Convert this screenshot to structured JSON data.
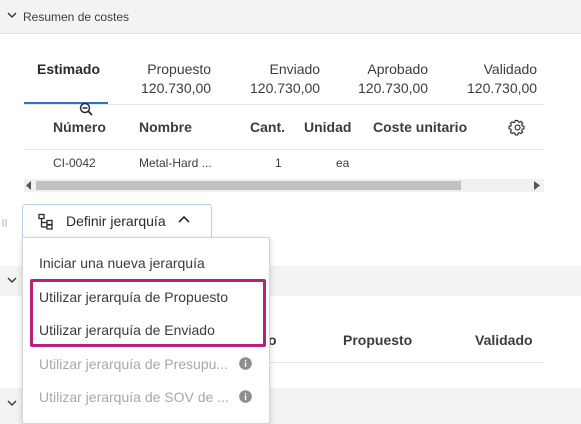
{
  "section": {
    "title": "Resumen de costes"
  },
  "tabs": [
    {
      "label": "Estimado",
      "amount": ""
    },
    {
      "label": "Propuesto",
      "amount": "120.730,00"
    },
    {
      "label": "Enviado",
      "amount": "120.730,00"
    },
    {
      "label": "Aprobado",
      "amount": "120.730,00"
    },
    {
      "label": "Validado",
      "amount": "120.730,00"
    }
  ],
  "table": {
    "headers": [
      "Número",
      "Nombre",
      "Cant.",
      "Unidad",
      "Coste unitario"
    ],
    "rows": [
      {
        "numero": "CI-0042",
        "nombre": "Metal-Hard ...",
        "cant": "1",
        "unidad": "ea"
      }
    ]
  },
  "button": {
    "label": "Definir jerarquía"
  },
  "menu": {
    "items": [
      {
        "label": "Iniciar una nueva jerarquía",
        "disabled": false
      },
      {
        "label": "Utilizar jerarquía de Propuesto",
        "disabled": false
      },
      {
        "label": "Utilizar jerarquía de Enviado",
        "disabled": false
      },
      {
        "label": "Utilizar jerarquía de Presupu...",
        "disabled": true
      },
      {
        "label": "Utilizar jerarquía de SOV de ...",
        "disabled": true
      }
    ]
  },
  "background_columns": {
    "col_partial": "o",
    "col_a": "Propuesto",
    "col_b": "Validado"
  },
  "colors": {
    "accent": "#2f6fd6",
    "highlight": "#b5237d"
  }
}
